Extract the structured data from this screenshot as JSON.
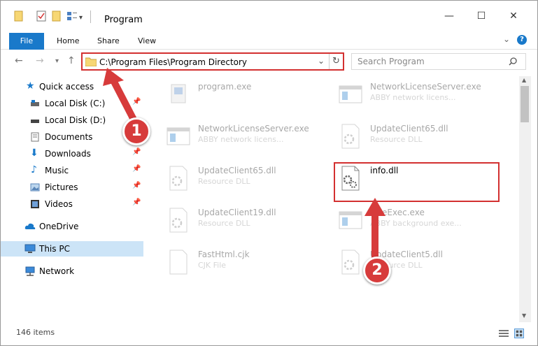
{
  "window": {
    "title": "Program"
  },
  "ribbon": {
    "file": "File",
    "home": "Home",
    "share": "Share",
    "view": "View"
  },
  "controls": {
    "minimize": "—",
    "maximize": "☐",
    "close": "✕",
    "expand": "⌄",
    "help": "?"
  },
  "address": {
    "path": "C:\\Program Files\\Program Directory",
    "search_placeholder": "Search Program"
  },
  "sidebar": {
    "items": [
      {
        "label": "Quick access",
        "icon": "star-icon"
      },
      {
        "label": "Local Disk (C:)",
        "icon": "disk-icon"
      },
      {
        "label": "Local Disk (D:)",
        "icon": "disk-icon"
      },
      {
        "label": "Documents",
        "icon": "documents-icon"
      },
      {
        "label": "Downloads",
        "icon": "downloads-icon"
      },
      {
        "label": "Music",
        "icon": "music-icon"
      },
      {
        "label": "Pictures",
        "icon": "pictures-icon"
      },
      {
        "label": "Videos",
        "icon": "videos-icon"
      },
      {
        "label": "OneDrive",
        "icon": "cloud-icon"
      },
      {
        "label": "This PC",
        "icon": "computer-icon"
      },
      {
        "label": "Network",
        "icon": "network-icon"
      }
    ]
  },
  "files": [
    {
      "name": "program.exe",
      "desc": ""
    },
    {
      "name": "NetworkLicenseServer.exe",
      "desc": "ABBY network licens..."
    },
    {
      "name": "NetworkLicenseServer.exe",
      "desc": "ABBY network licens..."
    },
    {
      "name": "UpdateClient65.dll",
      "desc": "Resource DLL"
    },
    {
      "name": "UpdateClient65.dll",
      "desc": "Resource DLL"
    },
    {
      "name": "info.dll",
      "desc": ""
    },
    {
      "name": "UpdateClient19.dll",
      "desc": "Resource DLL"
    },
    {
      "name": "OneExec.exe",
      "desc": "ABBY background exe..."
    },
    {
      "name": "FastHtml.cjk",
      "desc": "CJK File"
    },
    {
      "name": "UpdateClient5.dll",
      "desc": "Resource DLL"
    }
  ],
  "status": {
    "count": "146 items"
  },
  "callouts": {
    "one": "1",
    "two": "2"
  },
  "colors": {
    "accent": "#1979ca",
    "highlight": "#d33030",
    "selected": "#cce4f7"
  }
}
